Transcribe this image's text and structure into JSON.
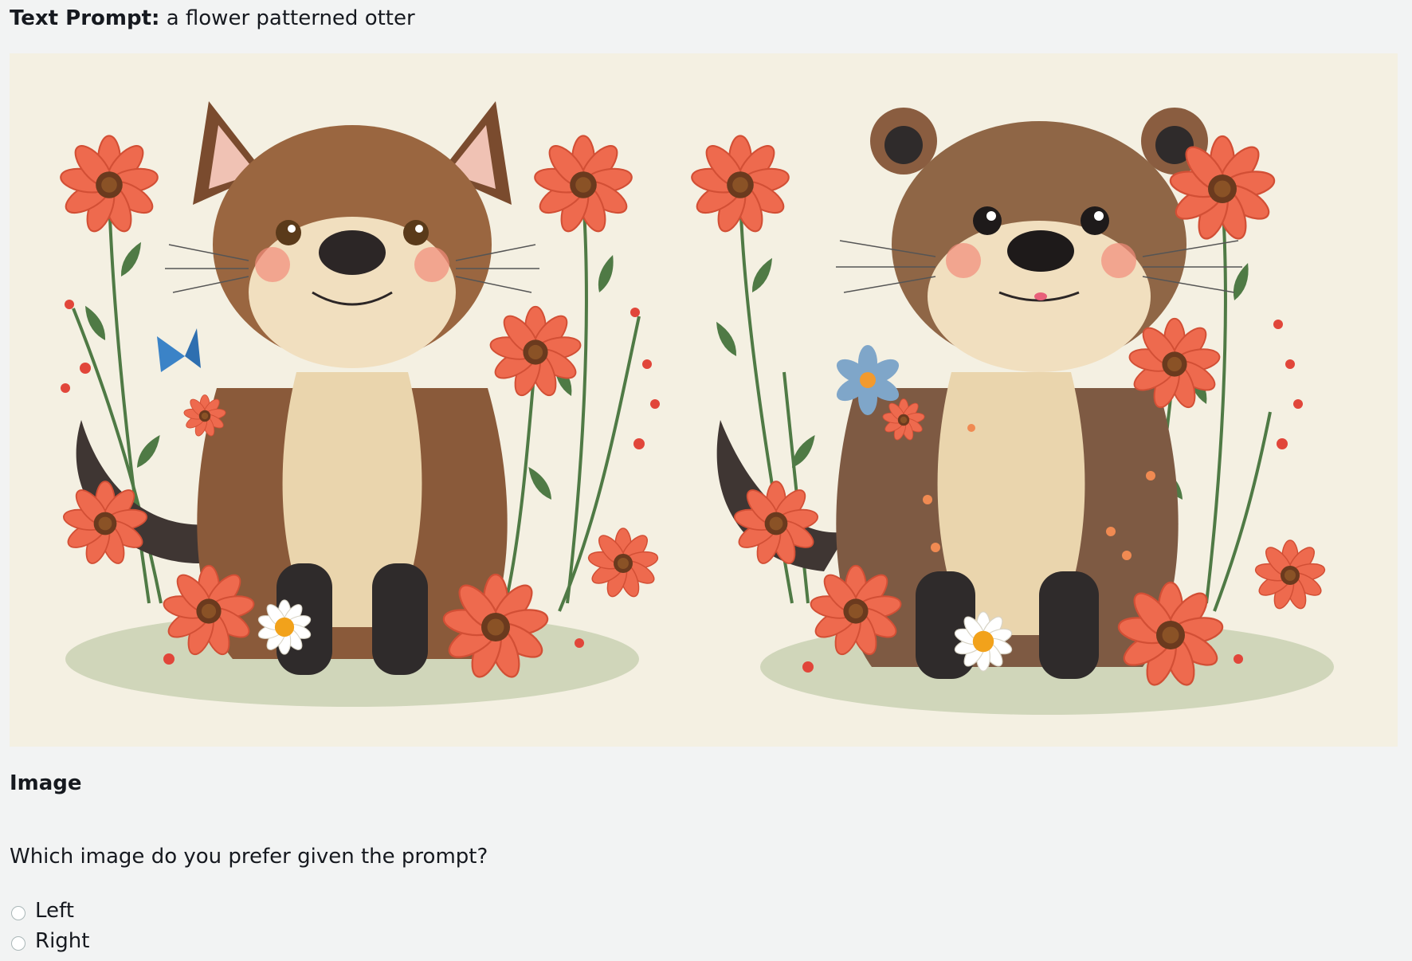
{
  "prompt": {
    "label": "Text Prompt:",
    "text": "a flower patterned otter"
  },
  "images": {
    "left": {
      "icon": "otter-illustration-icon"
    },
    "right": {
      "icon": "otter-illustration-icon"
    }
  },
  "section": {
    "heading": "Image"
  },
  "question": {
    "text": "Which image do you prefer given the prompt?",
    "options": [
      {
        "label": "Left"
      },
      {
        "label": "Right"
      }
    ]
  },
  "colors": {
    "background": "#f2f3f3",
    "image_background": "#f4f0e2",
    "fur_brown": "#8a5a3a",
    "flower_red": "#ee6a4e",
    "leaf_green": "#4f7a45"
  }
}
